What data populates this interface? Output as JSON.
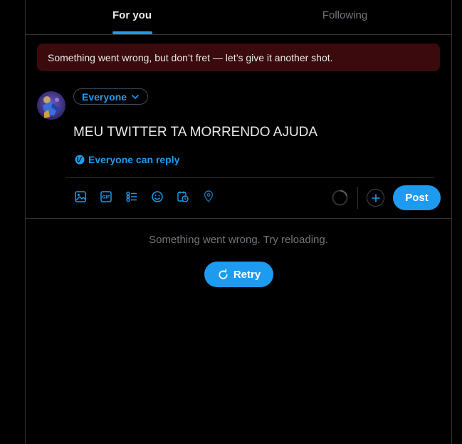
{
  "tabs": [
    {
      "label": "For you",
      "active": true
    },
    {
      "label": "Following",
      "active": false
    }
  ],
  "banner": {
    "text": "Something went wrong, but don’t fret — let’s give it another shot."
  },
  "composer": {
    "audience_label": "Everyone",
    "text": "MEU TWITTER TA MORRENDO AJUDA",
    "reply_setting": "Everyone can reply",
    "post_label": "Post",
    "toolbar_icons": [
      "media-icon",
      "gif-icon",
      "poll-icon",
      "emoji-icon",
      "schedule-icon",
      "location-icon"
    ]
  },
  "feed": {
    "error_text": "Something went wrong. Try reloading.",
    "retry_label": "Retry"
  },
  "colors": {
    "accent": "#1d9bf0",
    "banner_bg": "#3a0a0c",
    "muted_text": "#71767b",
    "border": "#2f3336"
  }
}
